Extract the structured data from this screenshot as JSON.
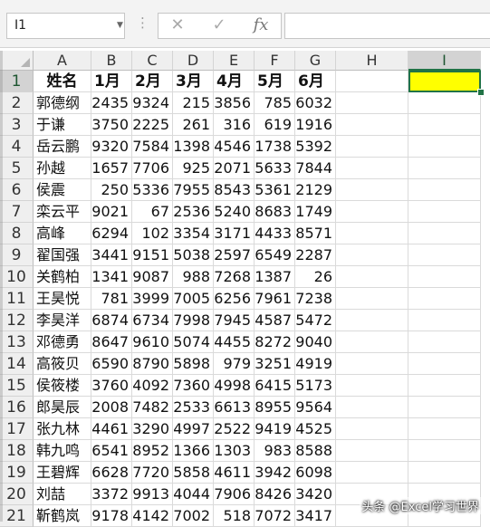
{
  "formula_bar": {
    "name_box": "I1",
    "cancel_icon": "✕",
    "enter_icon": "✓",
    "function_icon": "fx",
    "formula": ""
  },
  "columns": [
    "A",
    "B",
    "C",
    "D",
    "E",
    "F",
    "G",
    "H",
    "I"
  ],
  "active_column": "I",
  "header": [
    "姓名",
    "1月",
    "2月",
    "3月",
    "4月",
    "5月",
    "6月"
  ],
  "rows": [
    {
      "num": "2",
      "name": "郭德纲",
      "values": [
        "2435",
        "9324",
        "215",
        "3856",
        "785",
        "6032"
      ]
    },
    {
      "num": "3",
      "name": "于谦",
      "values": [
        "3750",
        "2225",
        "261",
        "316",
        "619",
        "1916"
      ]
    },
    {
      "num": "4",
      "name": "岳云鹏",
      "values": [
        "9320",
        "7584",
        "1398",
        "4546",
        "1738",
        "5392"
      ]
    },
    {
      "num": "5",
      "name": "孙越",
      "values": [
        "1657",
        "7706",
        "925",
        "2071",
        "5633",
        "7844"
      ]
    },
    {
      "num": "6",
      "name": "侯震",
      "values": [
        "250",
        "5336",
        "7955",
        "8543",
        "5361",
        "2129"
      ]
    },
    {
      "num": "7",
      "name": "栾云平",
      "values": [
        "9021",
        "67",
        "2536",
        "5240",
        "8683",
        "1749"
      ]
    },
    {
      "num": "8",
      "name": "高峰",
      "values": [
        "6294",
        "102",
        "3354",
        "3171",
        "4433",
        "8571"
      ]
    },
    {
      "num": "9",
      "name": "翟国强",
      "values": [
        "3441",
        "9151",
        "5038",
        "2597",
        "6549",
        "2287"
      ]
    },
    {
      "num": "10",
      "name": "关鹤柏",
      "values": [
        "1341",
        "9087",
        "988",
        "7268",
        "1387",
        "26"
      ]
    },
    {
      "num": "11",
      "name": "王昊悦",
      "values": [
        "781",
        "3999",
        "7005",
        "6256",
        "7961",
        "7238"
      ]
    },
    {
      "num": "12",
      "name": "李昊洋",
      "values": [
        "6874",
        "6734",
        "7998",
        "7945",
        "4587",
        "5472"
      ]
    },
    {
      "num": "13",
      "name": "邓德勇",
      "values": [
        "8647",
        "9610",
        "5074",
        "4455",
        "8272",
        "9040"
      ]
    },
    {
      "num": "14",
      "name": "高筱贝",
      "values": [
        "6590",
        "8790",
        "5898",
        "979",
        "3251",
        "4919"
      ]
    },
    {
      "num": "15",
      "name": "侯筱楼",
      "values": [
        "3760",
        "4092",
        "7360",
        "4998",
        "6415",
        "5173"
      ]
    },
    {
      "num": "16",
      "name": "郎昊辰",
      "values": [
        "2008",
        "7482",
        "2533",
        "6613",
        "8955",
        "9564"
      ]
    },
    {
      "num": "17",
      "name": "张九林",
      "values": [
        "4461",
        "3290",
        "4997",
        "2522",
        "9419",
        "4525"
      ]
    },
    {
      "num": "18",
      "name": "韩九鸣",
      "values": [
        "6541",
        "8952",
        "1366",
        "1303",
        "983",
        "8588"
      ]
    },
    {
      "num": "19",
      "name": "王碧辉",
      "values": [
        "6628",
        "7720",
        "5858",
        "4611",
        "3942",
        "6098"
      ]
    },
    {
      "num": "20",
      "name": "刘喆",
      "values": [
        "3372",
        "9913",
        "4044",
        "7906",
        "8426",
        "3420"
      ]
    },
    {
      "num": "21",
      "name": "靳鹤岚",
      "values": [
        "9178",
        "4142",
        "7002",
        "518",
        "7072",
        "3417"
      ]
    }
  ],
  "selected_cell": {
    "ref": "I1",
    "fill": "#ffff00",
    "border": "#217346"
  },
  "watermark": "头条 @Excel学习世界"
}
